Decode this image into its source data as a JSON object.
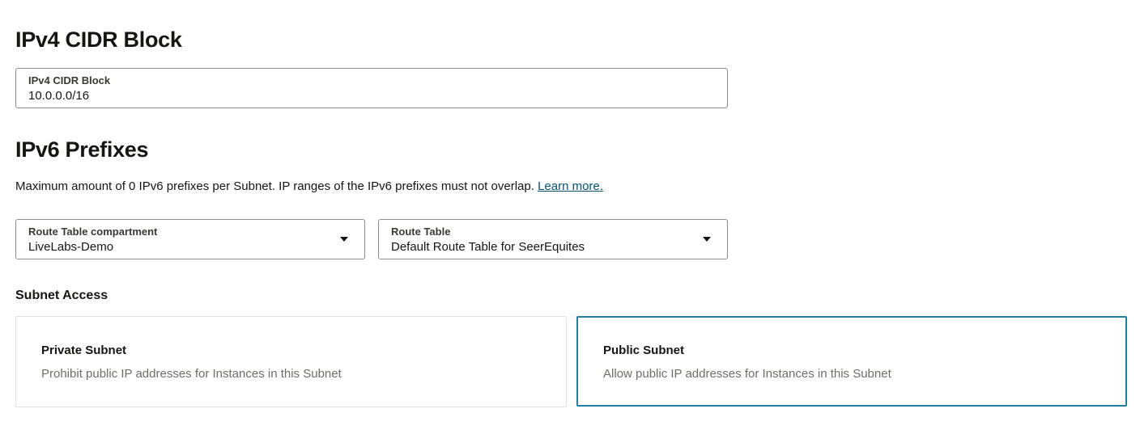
{
  "ipv4": {
    "title": "IPv4 CIDR Block",
    "field_label": "IPv4 CIDR Block",
    "field_value": "10.0.0.0/16"
  },
  "ipv6": {
    "title": "IPv6 Prefixes",
    "description": "Maximum amount of 0 IPv6 prefixes per Subnet. IP ranges of the IPv6 prefixes must not overlap.",
    "learn_more": "Learn more."
  },
  "route_table_compartment": {
    "label": "Route Table compartment",
    "value": "LiveLabs-Demo"
  },
  "route_table": {
    "label": "Route Table",
    "value": "Default Route Table for SeerEquites"
  },
  "subnet_access": {
    "label": "Subnet Access",
    "options": [
      {
        "title": "Private Subnet",
        "description": "Prohibit public IP addresses for Instances in this Subnet",
        "selected": false
      },
      {
        "title": "Public Subnet",
        "description": "Allow public IP addresses for Instances in this Subnet",
        "selected": true
      }
    ]
  },
  "colors": {
    "selected_border": "#227e9e",
    "link": "#04536f",
    "field_border": "#8f8c89",
    "card_border": "#e4e1dd"
  },
  "icons": {
    "dropdown": "chevron-down-icon"
  }
}
